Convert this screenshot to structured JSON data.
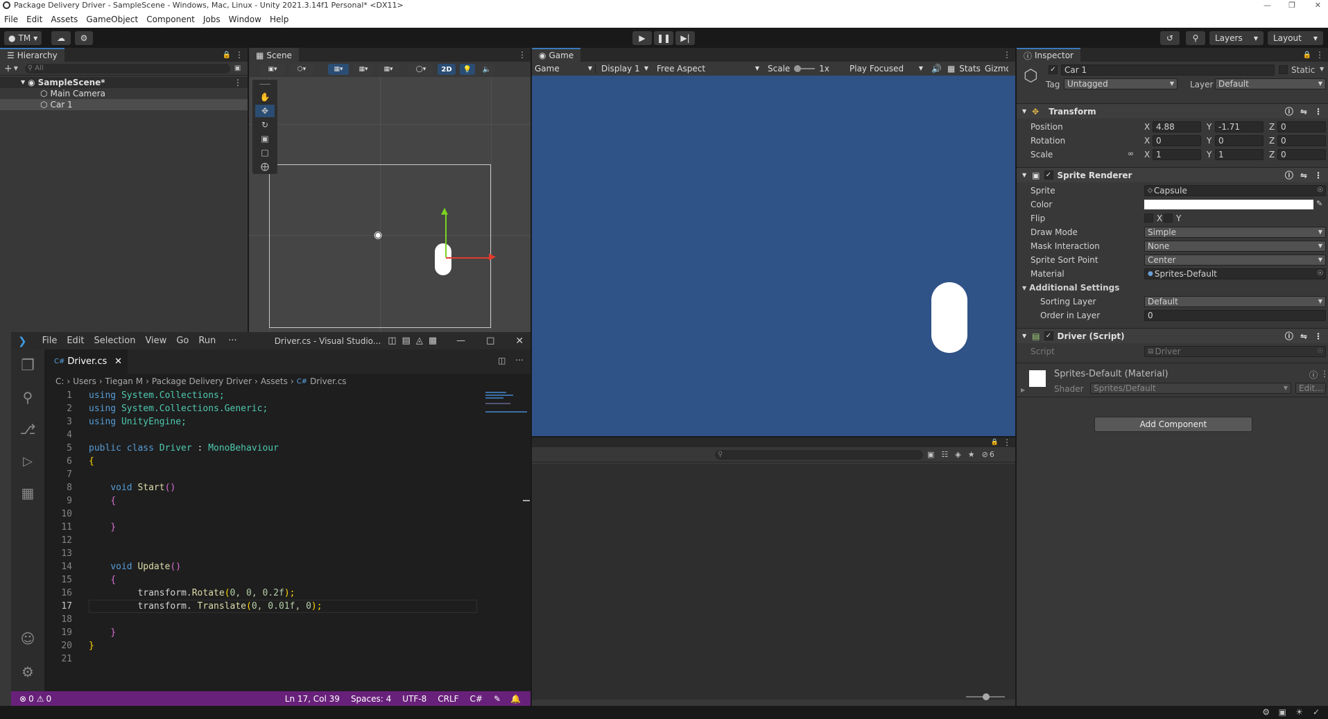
{
  "window": {
    "title": "Package Delivery Driver - SampleScene - Windows, Mac, Linux - Unity 2021.3.14f1 Personal* <DX11>"
  },
  "menu": [
    "File",
    "Edit",
    "Assets",
    "GameObject",
    "Component",
    "Jobs",
    "Window",
    "Help"
  ],
  "toolbar": {
    "account": "TM",
    "layers": "Layers",
    "layout": "Layout"
  },
  "hierarchy": {
    "tab": "Hierarchy",
    "search_placeholder": "All",
    "scene": "SampleScene*",
    "items": [
      "Main Camera",
      "Car 1"
    ]
  },
  "scene_view": {
    "tab": "Scene",
    "mode_2d": "2D"
  },
  "game_view": {
    "tab": "Game",
    "game_dropdown": "Game",
    "display": "Display 1",
    "aspect": "Free Aspect",
    "scale_label": "Scale",
    "scale_value": "1x",
    "play_mode": "Play Focused",
    "stats": "Stats",
    "gizmos": "Gizmo",
    "background_color": "#2f5287"
  },
  "console": {
    "count": "6"
  },
  "inspector": {
    "tab": "Inspector",
    "object_name": "Car 1",
    "static_label": "Static",
    "tag_label": "Tag",
    "tag_value": "Untagged",
    "layer_label": "Layer",
    "layer_value": "Default",
    "transform": {
      "title": "Transform",
      "position_label": "Position",
      "rotation_label": "Rotation",
      "scale_label": "Scale",
      "position": {
        "x": "4.88",
        "y": "-1.71",
        "z": "0"
      },
      "rotation": {
        "x": "0",
        "y": "0",
        "z": "0"
      },
      "scale": {
        "x": "1",
        "y": "1",
        "z": "0"
      }
    },
    "sprite_renderer": {
      "title": "Sprite Renderer",
      "sprite_label": "Sprite",
      "sprite_value": "Capsule",
      "color_label": "Color",
      "flip_label": "Flip",
      "flip_x": "X",
      "flip_y": "Y",
      "draw_mode_label": "Draw Mode",
      "draw_mode_value": "Simple",
      "mask_label": "Mask Interaction",
      "mask_value": "None",
      "sort_point_label": "Sprite Sort Point",
      "sort_point_value": "Center",
      "material_label": "Material",
      "material_value": "Sprites-Default",
      "additional_label": "Additional Settings",
      "sorting_layer_label": "Sorting Layer",
      "sorting_layer_value": "Default",
      "order_label": "Order in Layer",
      "order_value": "0"
    },
    "driver": {
      "title": "Driver (Script)",
      "script_label": "Script",
      "script_value": "Driver"
    },
    "material": {
      "title": "Sprites-Default (Material)",
      "shader_label": "Shader",
      "shader_value": "Sprites/Default",
      "edit_label": "Edit..."
    },
    "add_component": "Add Component"
  },
  "vscode": {
    "menu": [
      "File",
      "Edit",
      "Selection",
      "View",
      "Go",
      "Run",
      "···"
    ],
    "title": "Driver.cs - Visual Studio...",
    "tab": "Driver.cs",
    "breadcrumb": [
      "C:",
      "Users",
      "Tiegan M",
      "Package Delivery Driver",
      "Assets",
      "Driver.cs"
    ],
    "status": {
      "errors": "0",
      "warnings": "0",
      "position": "Ln 17, Col 39",
      "spaces": "Spaces: 4",
      "encoding": "UTF-8",
      "eol": "CRLF",
      "language": "C#"
    },
    "line_numbers": [
      "1",
      "2",
      "3",
      "4",
      "5",
      "6",
      "7",
      "8",
      "9",
      "10",
      "11",
      "12",
      "13",
      "14",
      "15",
      "16",
      "17",
      "18",
      "19",
      "20",
      "21"
    ],
    "code": {
      "l1_kw": "using",
      "l1_ns": " System.Collections;",
      "l2_kw": "using",
      "l2_ns": " System.Collections.Generic;",
      "l3_kw": "using",
      "l3_ns": " UnityEngine;",
      "l5_a": "public class",
      "l5_b": "Driver",
      "l5_c": " : ",
      "l5_d": "MonoBehaviour",
      "l6": "{",
      "l8_a": "void",
      "l8_b": "Start",
      "l8_c": "()",
      "l9": "{",
      "l11": "}",
      "l14_a": "void",
      "l14_b": "Update",
      "l14_c": "()",
      "l15": "{",
      "l16_a": "transform.",
      "l16_b": "Rotate",
      "l16_c": "(",
      "l16_d": "0, 0, 0.2f",
      "l16_e": ");",
      "l17_a": "transform. ",
      "l17_b": "Translate",
      "l17_c": "(",
      "l17_d": "0, 0.01f, 0",
      "l17_e": ");",
      "l19": "}",
      "l20": "}"
    }
  }
}
